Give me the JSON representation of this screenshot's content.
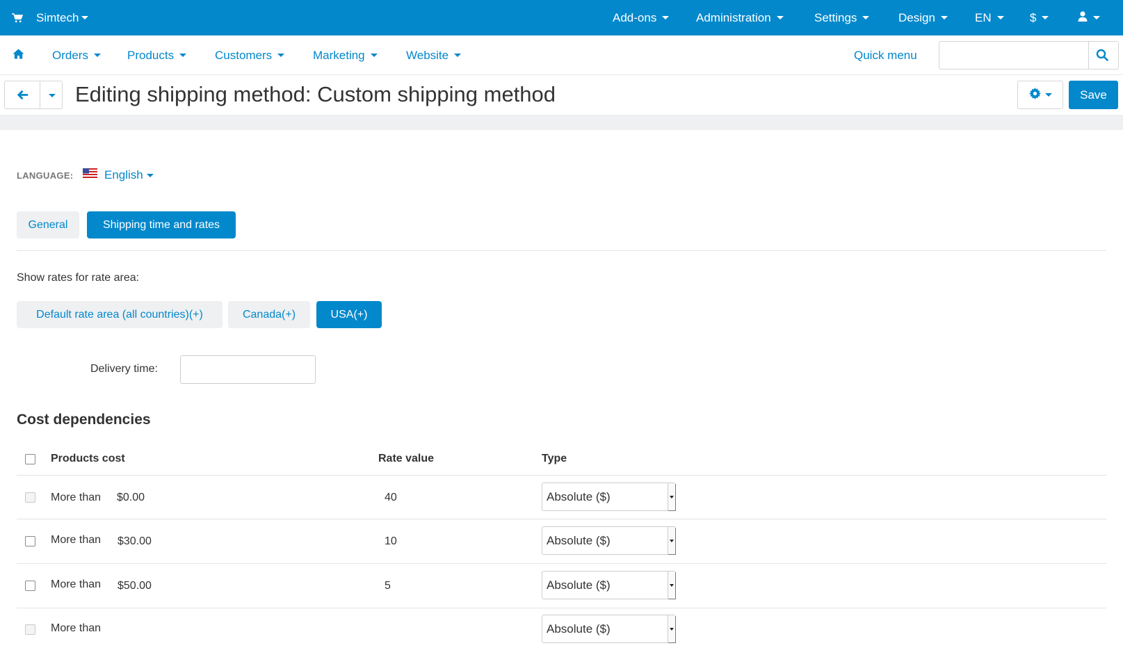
{
  "topbar": {
    "store_name": "Simtech",
    "menu": [
      "Add-ons",
      "Administration",
      "Settings",
      "Design",
      "EN",
      "$"
    ]
  },
  "nav": {
    "items": [
      "Orders",
      "Products",
      "Customers",
      "Marketing",
      "Website"
    ],
    "quick_menu": "Quick menu",
    "search_value": ""
  },
  "toolbar": {
    "title": "Editing shipping method: Custom shipping method",
    "save_label": "Save"
  },
  "language": {
    "label": "LANGUAGE:",
    "value": "English"
  },
  "tabs": [
    {
      "label": "General",
      "active": false
    },
    {
      "label": "Shipping time and rates",
      "active": true
    }
  ],
  "rate_area": {
    "label": "Show rates for rate area:",
    "options": [
      {
        "label": "Default rate area (all countries)(+)",
        "active": false
      },
      {
        "label": "Canada(+)",
        "active": false
      },
      {
        "label": "USA(+)",
        "active": true
      }
    ]
  },
  "delivery": {
    "label": "Delivery time:",
    "value": ""
  },
  "cost_dependencies": {
    "title": "Cost dependencies",
    "headers": {
      "products_cost": "Products cost",
      "rate_value": "Rate value",
      "type": "Type"
    },
    "rows": [
      {
        "prefix": "More than",
        "amount": "$0.00",
        "rate": "40",
        "type": "Absolute ($)",
        "checkbox_disabled": true
      },
      {
        "prefix": "More than",
        "amount": "$30.00",
        "rate": "10",
        "type": "Absolute ($)",
        "checkbox_disabled": false
      },
      {
        "prefix": "More than",
        "amount": "$50.00",
        "rate": "5",
        "type": "Absolute ($)",
        "checkbox_disabled": false
      },
      {
        "prefix": "More than",
        "amount": "",
        "rate": "",
        "type": "Absolute ($)",
        "checkbox_disabled": true
      }
    ]
  },
  "colors": {
    "primary": "#0388cc",
    "tab_inactive_bg": "#eef0f2",
    "text": "#333333"
  },
  "icons": [
    "cart-icon",
    "user-icon",
    "home-icon",
    "search-icon",
    "back-arrow-icon",
    "gear-icon",
    "us-flag-icon"
  ]
}
